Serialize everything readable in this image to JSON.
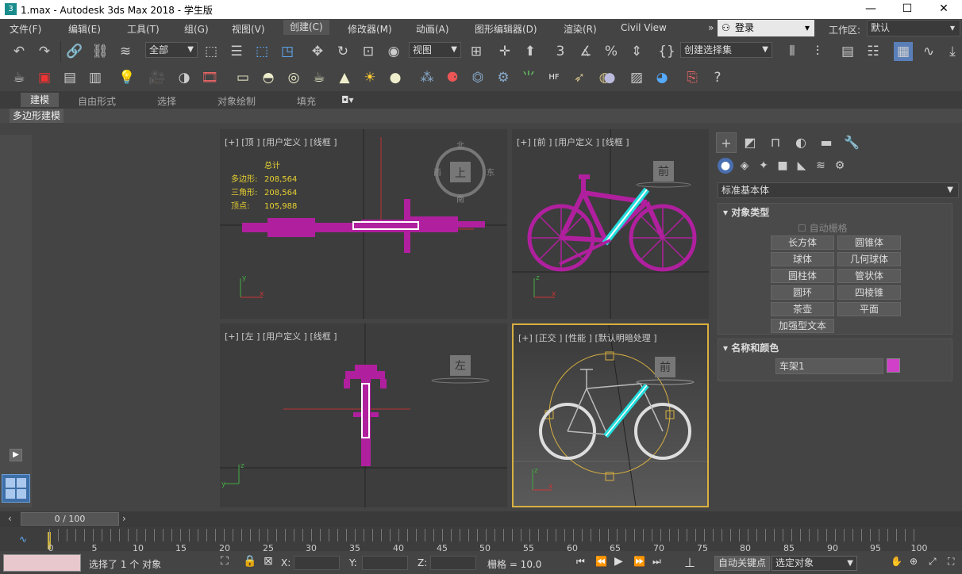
{
  "titlebar": {
    "title": "1.max - Autodesk 3ds Max 2018 - 学生版",
    "app_icon": "3",
    "minimize": "—",
    "maximize": "☐",
    "close": "✕"
  },
  "menu": {
    "items": [
      "文件(F)",
      "编辑(E)",
      "工具(T)",
      "组(G)",
      "视图(V)",
      "创建(C)",
      "修改器(M)",
      "动画(A)",
      "图形编辑器(D)",
      "渲染(R)",
      "Civil View"
    ],
    "expand": "»",
    "login": "登录",
    "workspace_label": "工作区:",
    "workspace_value": "默认"
  },
  "toolbar": {
    "selection_filter": "全部",
    "ref_coord": "视图",
    "named_selection": "创建选择集"
  },
  "ribbon": {
    "tabs": [
      "建模",
      "自由形式",
      "选择",
      "对象绘制",
      "填充"
    ],
    "active_tab": "建模",
    "sub_tab": "多边形建模"
  },
  "viewports": {
    "top": {
      "label": "[+] [顶 ] [用户定义 ] [线框 ]",
      "cube": "上",
      "compass": {
        "n": "北",
        "s": "南",
        "w": "西",
        "e": "东"
      }
    },
    "front": {
      "label": "[+] [前 ] [用户定义 ] [线框 ]",
      "cube": "前"
    },
    "left": {
      "label": "[+] [左 ] [用户定义 ] [线框 ]",
      "cube": "左"
    },
    "persp": {
      "label": "[+] [正交 ] [性能 ] [默认明暗处理 ]",
      "cube": "前"
    },
    "stats": {
      "header": "总计",
      "rows": [
        {
          "label": "多边形:",
          "value": "208,564"
        },
        {
          "label": "三角形:",
          "value": "208,564"
        },
        {
          "label": "顶点:",
          "value": "105,988"
        }
      ]
    },
    "axis": {
      "x": "x",
      "y": "y",
      "z": "z"
    }
  },
  "command_panel": {
    "category": "标准基本体",
    "object_type_title": "对象类型",
    "autogrid": "自动栅格",
    "buttons": [
      "长方体",
      "圆锥体",
      "球体",
      "几何球体",
      "圆柱体",
      "管状体",
      "圆环",
      "四棱锥",
      "茶壶",
      "平面",
      "加强型文本"
    ],
    "name_color_title": "名称和颜色",
    "object_name": "车架1",
    "object_color": "#d040c8"
  },
  "timeline": {
    "frame_display": "0 / 100",
    "ticks": [
      "0",
      "5",
      "10",
      "15",
      "20",
      "25",
      "30",
      "35",
      "40",
      "45",
      "50",
      "55",
      "60",
      "65",
      "70",
      "75",
      "80",
      "85",
      "90",
      "95",
      "100"
    ]
  },
  "status": {
    "selected": "选择了 1 个 对象",
    "x_label": "X:",
    "y_label": "Y:",
    "z_label": "Z:",
    "grid": "栅格 = 10.0",
    "auto_key": "自动关键点",
    "set_key_mode": "选定对象"
  }
}
